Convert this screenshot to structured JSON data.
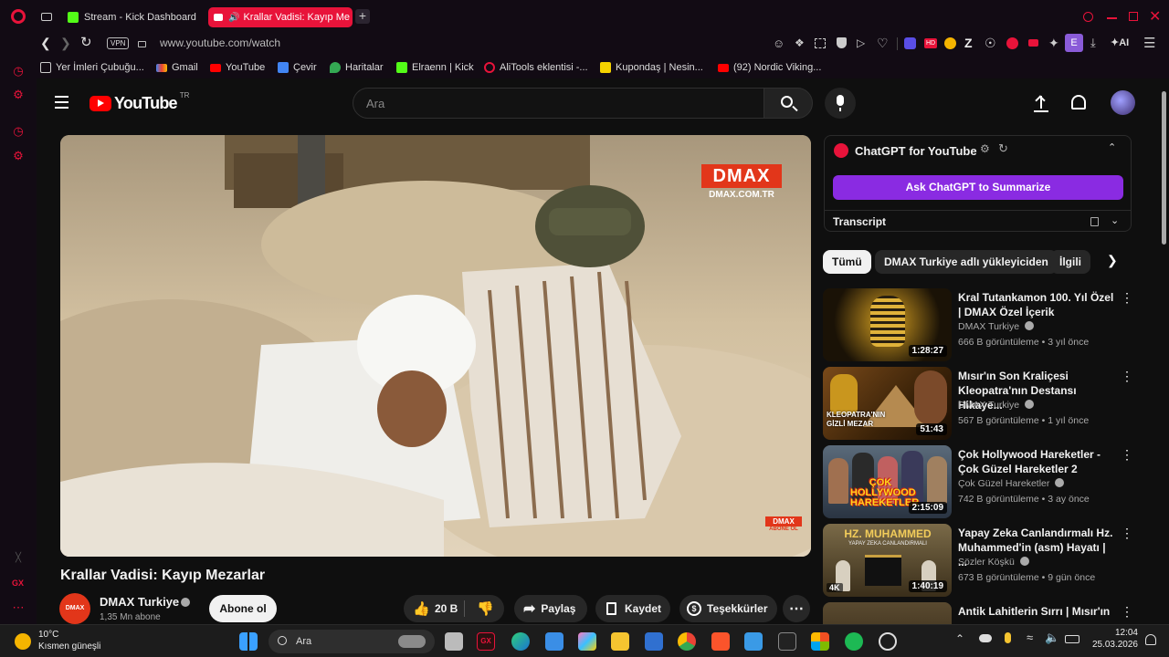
{
  "browser": {
    "tabs": [
      {
        "label": "Stream - Kick Dashboard"
      },
      {
        "label": "Krallar Vadisi: Kayıp Me"
      }
    ],
    "new_tab": "+",
    "vpn": "VPN",
    "url": "www.youtube.com/watch",
    "ai_label": "AI",
    "ext_letter": "E",
    "bookmarks": [
      "Yer İmleri Çubuğu...",
      "Gmail",
      "YouTube",
      "Çevir",
      "Haritalar",
      "Elraenn | Kick",
      "AliTools eklentisi -...",
      "Kupondaş | Nesin...",
      "(92) Nordic Viking..."
    ],
    "gx_label": "GX"
  },
  "youtube": {
    "logo_text": "YouTube",
    "region": "TR",
    "search_placeholder": "Ara"
  },
  "video": {
    "title": "Krallar Vadisi: Kayıp Mezarlar",
    "watermark_logo": "DMAX",
    "watermark_url": "DMAX.COM.TR",
    "corner_badge": "DMAX",
    "corner_badge_sub": "ABONE OL",
    "channel": "DMAX Turkiye",
    "subscribers": "1,35 Mn abone",
    "subscribe_label": "Abone ol",
    "likes": "20 B",
    "share_label": "Paylaş",
    "save_label": "Kaydet",
    "thanks_label": "Teşekkürler"
  },
  "chatgpt": {
    "title": "ChatGPT for YouTube",
    "summarize_label": "Ask ChatGPT to Summarize",
    "transcript_label": "Transcript",
    "accent": "#8a2be2"
  },
  "filters": [
    "Tümü",
    "DMAX Turkiye adlı yükleyiciden",
    "İlgili"
  ],
  "recommendations": [
    {
      "title": "Kral Tutankamon 100. Yıl Özel | DMAX Özel İçerik",
      "channel": "DMAX Turkiye",
      "meta": "666 B görüntüleme • 3 yıl önce",
      "duration": "1:28:27"
    },
    {
      "title": "Mısır'ın Son Kraliçesi Kleopatra'nın Destansı Hikaye...",
      "channel": "DMAX Turkiye",
      "meta": "567 B görüntüleme • 1 yıl önce",
      "duration": "51:43",
      "thumb_text": "KLEOPATRA'NIN GİZLİ MEZAR"
    },
    {
      "title": "Çok Hollywood Hareketler - Çok Güzel Hareketler 2",
      "channel": "Çok Güzel Hareketler",
      "meta": "742 B görüntüleme • 3 ay önce",
      "duration": "2:15:09",
      "thumb_text": "ÇOK HOLLYWOOD HAREKETLER"
    },
    {
      "title": "Yapay Zeka Canlandırmalı Hz. Muhammed'in (asm) Hayatı | ...",
      "channel": "Sözler Köşkü",
      "meta": "673 B görüntüleme • 9 gün önce",
      "duration": "1:40:19",
      "thumb_text": "HZ. MUHAMMED",
      "thumb_sub": "YAPAY ZEKA CANLANDIRMALI",
      "badge": "4K"
    },
    {
      "title": "Antik Lahitlerin Sırrı | Mısır'ın",
      "channel": "",
      "meta": "",
      "duration": ""
    }
  ],
  "taskbar": {
    "temperature": "10°C",
    "weather": "Kısmen güneşli",
    "search_label": "Ara",
    "time": "12:04",
    "date": "25.03.2026"
  }
}
